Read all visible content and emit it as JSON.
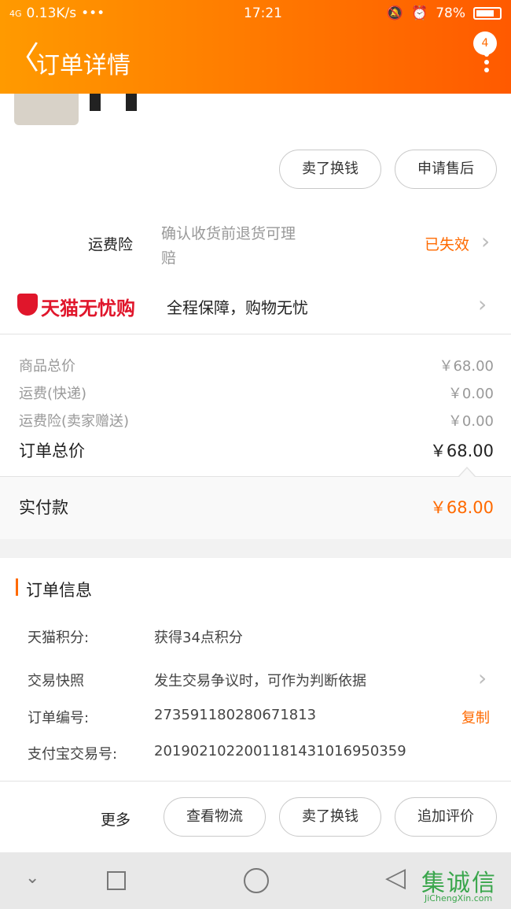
{
  "status_bar": {
    "signal": "4G",
    "speed": "0.13K/s",
    "dots": "•••",
    "time": "17:21",
    "battery": "78%",
    "battery_level": 0.78
  },
  "header": {
    "back_icon": "chevron-left-icon",
    "title": "订单详情",
    "badge": "4",
    "more_icon": "more-vertical-icon"
  },
  "actions_top": {
    "sell_label": "卖了换钱",
    "after_sale_label": "申请售后"
  },
  "shipping_insurance": {
    "label": "运费险",
    "desc_line1": "确认收货前退货可理",
    "desc_line2": "赔",
    "status": "已失效"
  },
  "tmall_worry_free": {
    "brand": "天猫无忧购",
    "slogan": "全程保障，购物无忧"
  },
  "price_breakdown": {
    "rows": [
      {
        "label": "商品总价",
        "value": "￥68.00"
      },
      {
        "label": "运费(快递)",
        "value": "￥0.00"
      },
      {
        "label": "运费险(卖家赠送)",
        "value": "￥0.00"
      }
    ],
    "total_label": "订单总价",
    "total_value": "￥68.00",
    "paid_label": "实付款",
    "paid_value": "￥68.00"
  },
  "order_info": {
    "section_title": "订单信息",
    "rows": [
      {
        "label": "天猫积分:",
        "value": "获得34点积分"
      },
      {
        "label": "交易快照",
        "value": "发生交易争议时，可作为判断依据"
      },
      {
        "label": "订单编号:",
        "value": "273591180280671813",
        "action": "复制"
      },
      {
        "label": "支付宝交易号:",
        "value": "2019021022001181431016950359"
      }
    ]
  },
  "bottom_actions": {
    "more_label": "更多",
    "logistics_label": "查看物流",
    "sell_label": "卖了换钱",
    "review_label": "追加评价"
  },
  "watermark": {
    "text": "集诚信",
    "url": "JiChengXin.com"
  },
  "colors": {
    "accent": "#ff6a00",
    "tmall_red": "#e0162b"
  }
}
